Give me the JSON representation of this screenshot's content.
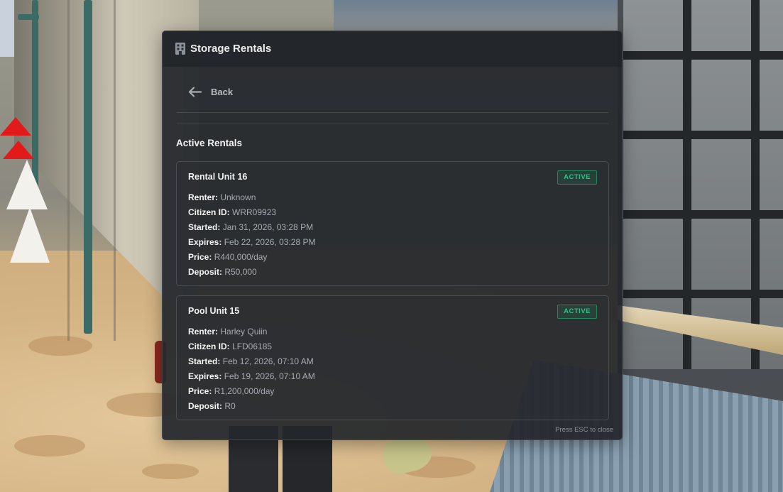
{
  "window": {
    "title": "Storage Rentals",
    "title_icon": "building-icon"
  },
  "nav": {
    "back_label": "Back",
    "back_icon": "arrow-left-icon"
  },
  "section": {
    "title": "Active Rentals"
  },
  "rentals": [
    {
      "name": "Rental Unit 16",
      "status": "ACTIVE",
      "renter_label": "Renter:",
      "renter": "Unknown",
      "citizen_label": "Citizen ID:",
      "citizen_id": "WRR09923",
      "started_label": "Started:",
      "started": "Jan 31, 2026, 03:28 PM",
      "expires_label": "Expires:",
      "expires": "Feb 22, 2026, 03:28 PM",
      "price_label": "Price:",
      "price": "R440,000/day",
      "deposit_label": "Deposit:",
      "deposit": "R50,000"
    },
    {
      "name": "Pool Unit 15",
      "status": "ACTIVE",
      "renter_label": "Renter:",
      "renter": "Harley Quiin",
      "citizen_label": "Citizen ID:",
      "citizen_id": "LFD06185",
      "started_label": "Started:",
      "started": "Feb 12, 2026, 07:10 AM",
      "expires_label": "Expires:",
      "expires": "Feb 19, 2026, 07:10 AM",
      "price_label": "Price:",
      "price": "R1,200,000/day",
      "deposit_label": "Deposit:",
      "deposit": "R0"
    }
  ],
  "footer": {
    "hint": "Press ESC to close"
  },
  "colors": {
    "modal_bg": "#24272b",
    "status_active": "#2fc38a",
    "text_primary": "#f2f2f2",
    "text_muted": "#a6abb2"
  }
}
